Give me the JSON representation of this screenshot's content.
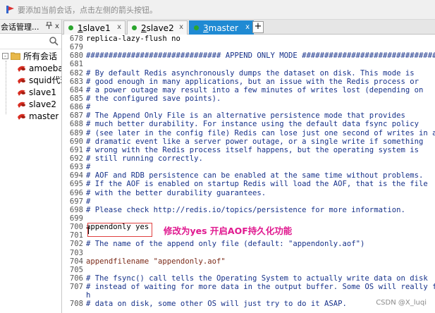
{
  "hint_bar": {
    "text": "要添加当前会话，点击左侧的箭头按钮。"
  },
  "session_panel": {
    "title": "会话管理...",
    "pin_glyph": " ",
    "close_glyph": "x",
    "root": {
      "label": "所有会话",
      "expander": "-"
    },
    "sessions": [
      "amoeba",
      "squid代理",
      "slave1",
      "slave2",
      "master"
    ]
  },
  "tabs": [
    {
      "num": "1",
      "name": " slave1",
      "status_color": "#2aa52e",
      "active": false
    },
    {
      "num": "2",
      "name": " slave2",
      "status_color": "#2aa52e",
      "active": false
    },
    {
      "num": "3",
      "name": " master",
      "status_color": "#2aa52e",
      "active": true
    }
  ],
  "tab_close_glyph": "x",
  "add_tab_glyph": "+",
  "editor": {
    "lines": [
      {
        "n": "678",
        "t": "replica-lazy-flush no"
      },
      {
        "n": "679",
        "t": ""
      },
      {
        "n": "680",
        "t": "############################## APPEND ONLY MODE ###############################"
      },
      {
        "n": "681",
        "t": ""
      },
      {
        "n": "682",
        "t": "# By default Redis asynchronously dumps the dataset on disk. This mode is"
      },
      {
        "n": "683",
        "t": "# good enough in many applications, but an issue with the Redis process or"
      },
      {
        "n": "684",
        "t": "# a power outage may result into a few minutes of writes lost (depending on"
      },
      {
        "n": "685",
        "t": "# the configured save points)."
      },
      {
        "n": "686",
        "t": "#"
      },
      {
        "n": "687",
        "t": "# The Append Only File is an alternative persistence mode that provides"
      },
      {
        "n": "688",
        "t": "# much better durability. For instance using the default data fsync policy"
      },
      {
        "n": "689",
        "t": "# (see later in the config file) Redis can lose just one second of writes in a"
      },
      {
        "n": "690",
        "t": "# dramatic event like a server power outage, or a single write if something"
      },
      {
        "n": "691",
        "t": "# wrong with the Redis process itself happens, but the operating system is"
      },
      {
        "n": "692",
        "t": "# still running correctly."
      },
      {
        "n": "693",
        "t": "#"
      },
      {
        "n": "694",
        "t": "# AOF and RDB persistence can be enabled at the same time without problems."
      },
      {
        "n": "695",
        "t": "# If the AOF is enabled on startup Redis will load the AOF, that is the file"
      },
      {
        "n": "696",
        "t": "# with the better durability guarantees."
      },
      {
        "n": "697",
        "t": "#"
      },
      {
        "n": "698",
        "t": "# Please check http://redis.io/topics/persistence for more information."
      },
      {
        "n": "699",
        "t": ""
      },
      {
        "n": "700",
        "t": "appendonly yes"
      },
      {
        "n": "701",
        "t": ""
      },
      {
        "n": "702",
        "t": "# The name of the append only file (default: \"appendonly.aof\")"
      },
      {
        "n": "703",
        "t": ""
      },
      {
        "n": "704",
        "t": "appendfilename \"appendonly.aof\""
      },
      {
        "n": "705",
        "t": ""
      },
      {
        "n": "706",
        "t": "# The fsync() call tells the Operating System to actually write data on disk"
      },
      {
        "n": "707",
        "t": "# instead of waiting for more data in the output buffer. Some OS will really flus"
      },
      {
        "n": "",
        "t": "h"
      },
      {
        "n": "708",
        "t": "# data on disk, some other OS will just try to do it ASAP."
      }
    ]
  },
  "annotation": "修改为yes 开启AOF持久化功能",
  "watermark": "CSDN @X_luqi",
  "colors": {
    "comment": "#17328a",
    "string": "#7b2a18",
    "active_tab": "#1f8ad3",
    "annotation": "#e0198f",
    "highlight_box": "#e04040"
  }
}
